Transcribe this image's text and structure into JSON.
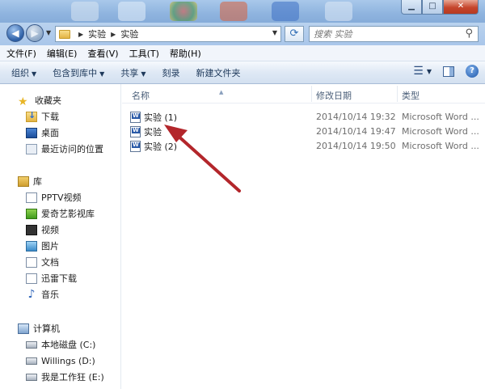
{
  "address": {
    "crumbs": [
      "实验",
      "实验"
    ],
    "search_placeholder": "搜索 实验"
  },
  "menu": [
    "文件(F)",
    "编辑(E)",
    "查看(V)",
    "工具(T)",
    "帮助(H)"
  ],
  "toolbar": {
    "organize": "组织",
    "include_library": "包含到库中",
    "share": "共享",
    "burn": "刻录",
    "new_folder": "新建文件夹"
  },
  "columns": {
    "name": "名称",
    "date": "修改日期",
    "type": "类型"
  },
  "files": [
    {
      "name": "实验 (1)",
      "date": "2014/10/14 19:32",
      "type": "Microsoft Word ..."
    },
    {
      "name": "实验",
      "date": "2014/10/14 19:47",
      "type": "Microsoft Word ..."
    },
    {
      "name": "实验 (2)",
      "date": "2014/10/14 19:50",
      "type": "Microsoft Word ..."
    }
  ],
  "nav": {
    "favorites": {
      "label": "收藏夹",
      "items": [
        "下载",
        "桌面",
        "最近访问的位置"
      ]
    },
    "libraries": {
      "label": "库",
      "items": [
        "PPTV视频",
        "爱奇艺影视库",
        "视频",
        "图片",
        "文档",
        "迅雷下载",
        "音乐"
      ]
    },
    "computer": {
      "label": "计算机",
      "items": [
        "本地磁盘 (C:)",
        "Willings (D:)",
        "我是工作狂 (E:)"
      ]
    }
  },
  "colors": {
    "annotation_arrow": "#b3262b",
    "title_glass": "#8fb4df"
  }
}
